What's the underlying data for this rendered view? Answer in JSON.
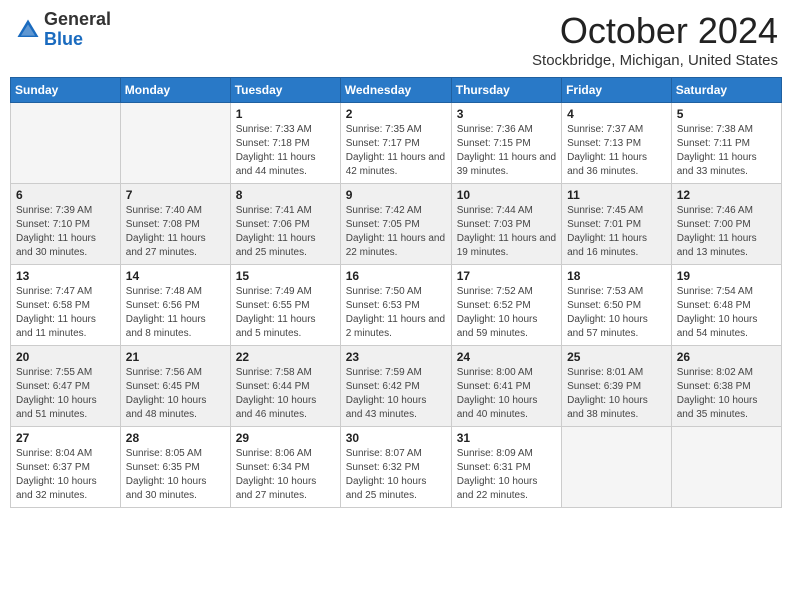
{
  "header": {
    "logo_general": "General",
    "logo_blue": "Blue",
    "title": "October 2024",
    "location": "Stockbridge, Michigan, United States"
  },
  "weekdays": [
    "Sunday",
    "Monday",
    "Tuesday",
    "Wednesday",
    "Thursday",
    "Friday",
    "Saturday"
  ],
  "weeks": [
    [
      {
        "day": "",
        "sunrise": "",
        "sunset": "",
        "daylight": ""
      },
      {
        "day": "",
        "sunrise": "",
        "sunset": "",
        "daylight": ""
      },
      {
        "day": "1",
        "sunrise": "Sunrise: 7:33 AM",
        "sunset": "Sunset: 7:18 PM",
        "daylight": "Daylight: 11 hours and 44 minutes."
      },
      {
        "day": "2",
        "sunrise": "Sunrise: 7:35 AM",
        "sunset": "Sunset: 7:17 PM",
        "daylight": "Daylight: 11 hours and 42 minutes."
      },
      {
        "day": "3",
        "sunrise": "Sunrise: 7:36 AM",
        "sunset": "Sunset: 7:15 PM",
        "daylight": "Daylight: 11 hours and 39 minutes."
      },
      {
        "day": "4",
        "sunrise": "Sunrise: 7:37 AM",
        "sunset": "Sunset: 7:13 PM",
        "daylight": "Daylight: 11 hours and 36 minutes."
      },
      {
        "day": "5",
        "sunrise": "Sunrise: 7:38 AM",
        "sunset": "Sunset: 7:11 PM",
        "daylight": "Daylight: 11 hours and 33 minutes."
      }
    ],
    [
      {
        "day": "6",
        "sunrise": "Sunrise: 7:39 AM",
        "sunset": "Sunset: 7:10 PM",
        "daylight": "Daylight: 11 hours and 30 minutes."
      },
      {
        "day": "7",
        "sunrise": "Sunrise: 7:40 AM",
        "sunset": "Sunset: 7:08 PM",
        "daylight": "Daylight: 11 hours and 27 minutes."
      },
      {
        "day": "8",
        "sunrise": "Sunrise: 7:41 AM",
        "sunset": "Sunset: 7:06 PM",
        "daylight": "Daylight: 11 hours and 25 minutes."
      },
      {
        "day": "9",
        "sunrise": "Sunrise: 7:42 AM",
        "sunset": "Sunset: 7:05 PM",
        "daylight": "Daylight: 11 hours and 22 minutes."
      },
      {
        "day": "10",
        "sunrise": "Sunrise: 7:44 AM",
        "sunset": "Sunset: 7:03 PM",
        "daylight": "Daylight: 11 hours and 19 minutes."
      },
      {
        "day": "11",
        "sunrise": "Sunrise: 7:45 AM",
        "sunset": "Sunset: 7:01 PM",
        "daylight": "Daylight: 11 hours and 16 minutes."
      },
      {
        "day": "12",
        "sunrise": "Sunrise: 7:46 AM",
        "sunset": "Sunset: 7:00 PM",
        "daylight": "Daylight: 11 hours and 13 minutes."
      }
    ],
    [
      {
        "day": "13",
        "sunrise": "Sunrise: 7:47 AM",
        "sunset": "Sunset: 6:58 PM",
        "daylight": "Daylight: 11 hours and 11 minutes."
      },
      {
        "day": "14",
        "sunrise": "Sunrise: 7:48 AM",
        "sunset": "Sunset: 6:56 PM",
        "daylight": "Daylight: 11 hours and 8 minutes."
      },
      {
        "day": "15",
        "sunrise": "Sunrise: 7:49 AM",
        "sunset": "Sunset: 6:55 PM",
        "daylight": "Daylight: 11 hours and 5 minutes."
      },
      {
        "day": "16",
        "sunrise": "Sunrise: 7:50 AM",
        "sunset": "Sunset: 6:53 PM",
        "daylight": "Daylight: 11 hours and 2 minutes."
      },
      {
        "day": "17",
        "sunrise": "Sunrise: 7:52 AM",
        "sunset": "Sunset: 6:52 PM",
        "daylight": "Daylight: 10 hours and 59 minutes."
      },
      {
        "day": "18",
        "sunrise": "Sunrise: 7:53 AM",
        "sunset": "Sunset: 6:50 PM",
        "daylight": "Daylight: 10 hours and 57 minutes."
      },
      {
        "day": "19",
        "sunrise": "Sunrise: 7:54 AM",
        "sunset": "Sunset: 6:48 PM",
        "daylight": "Daylight: 10 hours and 54 minutes."
      }
    ],
    [
      {
        "day": "20",
        "sunrise": "Sunrise: 7:55 AM",
        "sunset": "Sunset: 6:47 PM",
        "daylight": "Daylight: 10 hours and 51 minutes."
      },
      {
        "day": "21",
        "sunrise": "Sunrise: 7:56 AM",
        "sunset": "Sunset: 6:45 PM",
        "daylight": "Daylight: 10 hours and 48 minutes."
      },
      {
        "day": "22",
        "sunrise": "Sunrise: 7:58 AM",
        "sunset": "Sunset: 6:44 PM",
        "daylight": "Daylight: 10 hours and 46 minutes."
      },
      {
        "day": "23",
        "sunrise": "Sunrise: 7:59 AM",
        "sunset": "Sunset: 6:42 PM",
        "daylight": "Daylight: 10 hours and 43 minutes."
      },
      {
        "day": "24",
        "sunrise": "Sunrise: 8:00 AM",
        "sunset": "Sunset: 6:41 PM",
        "daylight": "Daylight: 10 hours and 40 minutes."
      },
      {
        "day": "25",
        "sunrise": "Sunrise: 8:01 AM",
        "sunset": "Sunset: 6:39 PM",
        "daylight": "Daylight: 10 hours and 38 minutes."
      },
      {
        "day": "26",
        "sunrise": "Sunrise: 8:02 AM",
        "sunset": "Sunset: 6:38 PM",
        "daylight": "Daylight: 10 hours and 35 minutes."
      }
    ],
    [
      {
        "day": "27",
        "sunrise": "Sunrise: 8:04 AM",
        "sunset": "Sunset: 6:37 PM",
        "daylight": "Daylight: 10 hours and 32 minutes."
      },
      {
        "day": "28",
        "sunrise": "Sunrise: 8:05 AM",
        "sunset": "Sunset: 6:35 PM",
        "daylight": "Daylight: 10 hours and 30 minutes."
      },
      {
        "day": "29",
        "sunrise": "Sunrise: 8:06 AM",
        "sunset": "Sunset: 6:34 PM",
        "daylight": "Daylight: 10 hours and 27 minutes."
      },
      {
        "day": "30",
        "sunrise": "Sunrise: 8:07 AM",
        "sunset": "Sunset: 6:32 PM",
        "daylight": "Daylight: 10 hours and 25 minutes."
      },
      {
        "day": "31",
        "sunrise": "Sunrise: 8:09 AM",
        "sunset": "Sunset: 6:31 PM",
        "daylight": "Daylight: 10 hours and 22 minutes."
      },
      {
        "day": "",
        "sunrise": "",
        "sunset": "",
        "daylight": ""
      },
      {
        "day": "",
        "sunrise": "",
        "sunset": "",
        "daylight": ""
      }
    ]
  ]
}
